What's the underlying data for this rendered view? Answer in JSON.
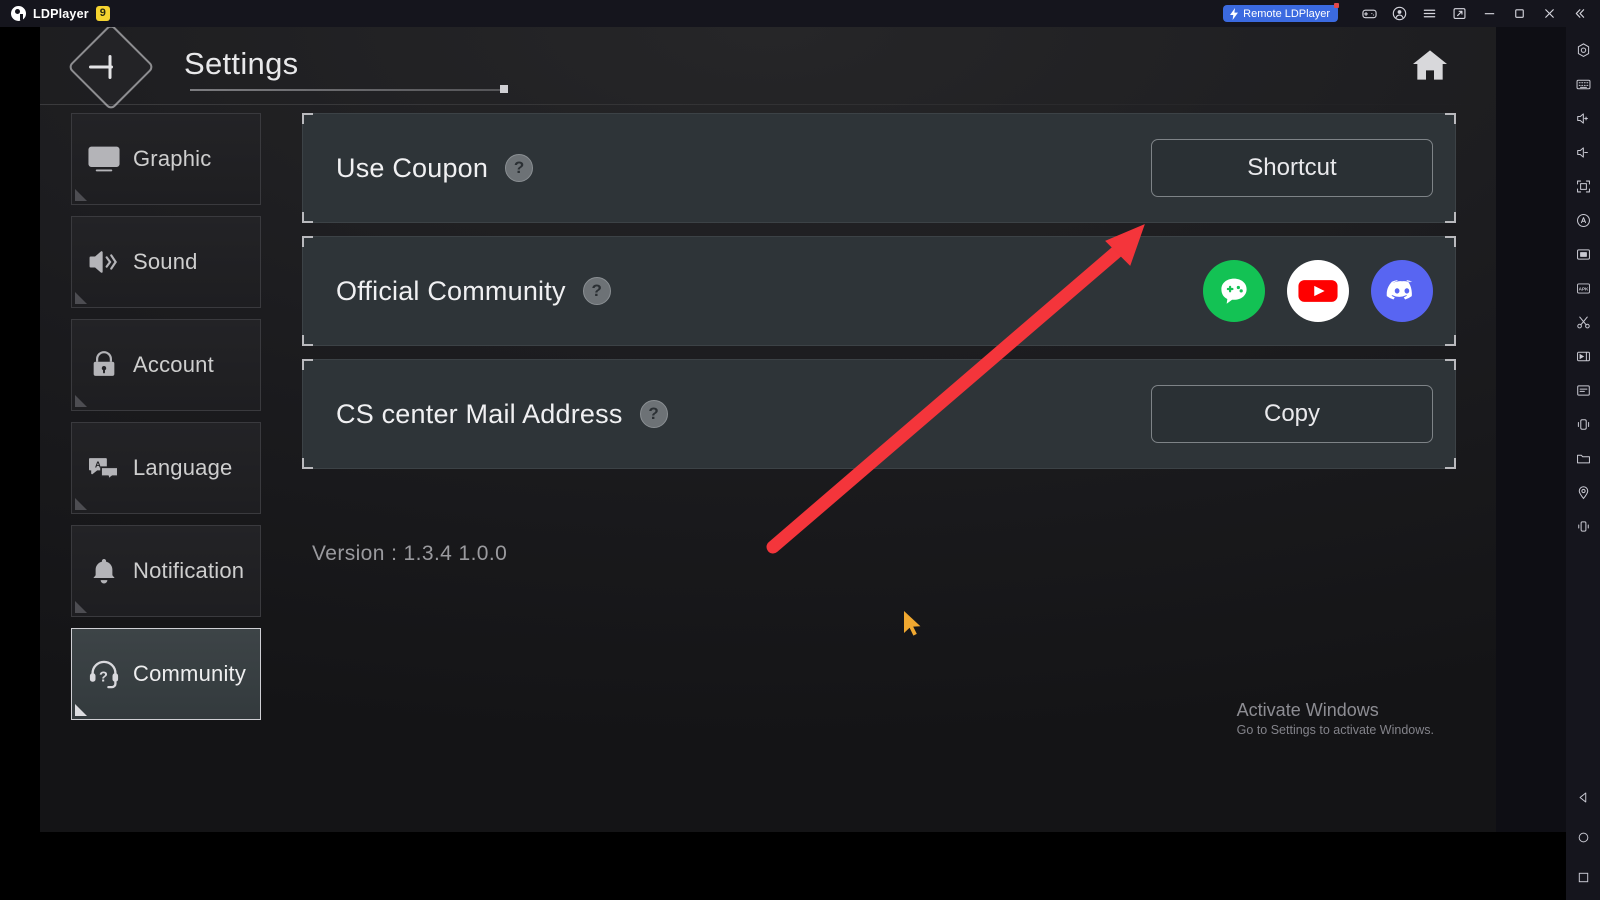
{
  "titlebar": {
    "app_name": "LDPlayer",
    "version_badge": "9",
    "remote_label": "Remote LDPlayer",
    "icons": [
      {
        "name": "gamepad-icon"
      },
      {
        "name": "account-icon"
      },
      {
        "name": "menu-icon"
      },
      {
        "name": "multi-instance-icon"
      },
      {
        "name": "minimize-icon"
      },
      {
        "name": "maximize-icon"
      },
      {
        "name": "close-icon"
      },
      {
        "name": "collapse-icon"
      }
    ]
  },
  "rail": {
    "items": [
      {
        "name": "settings-gear-icon"
      },
      {
        "name": "keyboard-icon"
      },
      {
        "name": "volume-up-icon"
      },
      {
        "name": "volume-down-icon"
      },
      {
        "name": "fullscreen-icon"
      },
      {
        "name": "auto-rotate-icon"
      },
      {
        "name": "screenshot-icon"
      },
      {
        "name": "install-apk-icon"
      },
      {
        "name": "scissors-icon"
      },
      {
        "name": "video-record-icon"
      },
      {
        "name": "script-icon"
      },
      {
        "name": "shake-icon"
      },
      {
        "name": "folder-icon"
      },
      {
        "name": "location-icon"
      },
      {
        "name": "vibrate-icon"
      }
    ],
    "nav": [
      {
        "name": "android-back-icon"
      },
      {
        "name": "android-home-icon"
      },
      {
        "name": "android-recents-icon"
      }
    ]
  },
  "game": {
    "header": {
      "title": "Settings",
      "back_icon": "back-arrow-icon",
      "home_icon": "home-icon"
    },
    "menu": [
      {
        "label": "Graphic",
        "icon": "monitor-icon",
        "selected": false
      },
      {
        "label": "Sound",
        "icon": "speaker-icon",
        "selected": false
      },
      {
        "label": "Account",
        "icon": "lock-icon",
        "selected": false
      },
      {
        "label": "Language",
        "icon": "translate-icon",
        "selected": false
      },
      {
        "label": "Notification",
        "icon": "bell-icon",
        "selected": false
      },
      {
        "label": "Community",
        "icon": "headset-help-icon",
        "selected": true
      }
    ],
    "panels": [
      {
        "label": "Use Coupon",
        "help": "?",
        "control": "button",
        "button_label": "Shortcut"
      },
      {
        "label": "Official Community",
        "help": "?",
        "control": "socials",
        "socials": [
          {
            "name": "game-community-icon",
            "color": "#13c254"
          },
          {
            "name": "youtube-icon",
            "color": "#ff0000"
          },
          {
            "name": "discord-icon",
            "color": "#5865f2"
          }
        ]
      },
      {
        "label": "CS center Mail Address",
        "help": "?",
        "control": "button",
        "button_label": "Copy"
      }
    ],
    "version_text": "Version : 1.3.4    1.0.0"
  },
  "watermark": {
    "title": "Activate Windows",
    "subtitle": "Go to Settings to activate Windows."
  },
  "annotation": {
    "arrow_color": "#f4353b",
    "cursor_color": "#f0a830"
  }
}
